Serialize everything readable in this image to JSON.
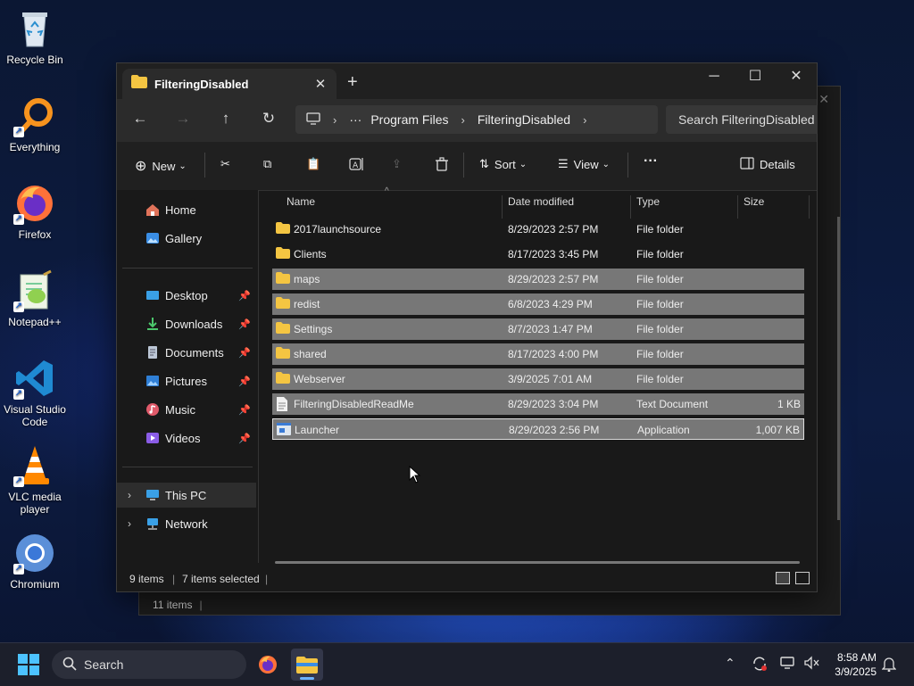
{
  "desktop": {
    "icons": [
      {
        "label": "Recycle Bin"
      },
      {
        "label": "Everything"
      },
      {
        "label": "Firefox"
      },
      {
        "label": "Notepad++"
      },
      {
        "label": "Visual Studio Code"
      },
      {
        "label": "VLC media player"
      },
      {
        "label": "Chromium"
      }
    ]
  },
  "background_window": {
    "status": "11 items"
  },
  "window": {
    "tab_title": "FilteringDisabled",
    "new_tab": "+",
    "controls": {
      "minimize": "─",
      "maximize": "☐",
      "close": "✕"
    },
    "breadcrumb": [
      "Program Files",
      "FilteringDisabled"
    ],
    "breadcrumb_more": "···",
    "search_placeholder": "Search FilteringDisabled",
    "toolbar": {
      "new_label": "New",
      "sort_label": "Sort",
      "view_label": "View",
      "more_label": "···",
      "details_label": "Details"
    },
    "sidebar": {
      "home": "Home",
      "gallery": "Gallery",
      "desktop": "Desktop",
      "downloads": "Downloads",
      "documents": "Documents",
      "pictures": "Pictures",
      "music": "Music",
      "videos": "Videos",
      "this_pc": "This PC",
      "network": "Network"
    },
    "columns": {
      "name": "Name",
      "date": "Date modified",
      "type": "Type",
      "size": "Size"
    },
    "files": [
      {
        "name": "2017launchsource",
        "date": "8/29/2023 2:57 PM",
        "type": "File folder",
        "size": "",
        "selected": false,
        "kind": "folder"
      },
      {
        "name": "Clients",
        "date": "8/17/2023 3:45 PM",
        "type": "File folder",
        "size": "",
        "selected": false,
        "kind": "folder"
      },
      {
        "name": "maps",
        "date": "8/29/2023 2:57 PM",
        "type": "File folder",
        "size": "",
        "selected": true,
        "kind": "folder"
      },
      {
        "name": "redist",
        "date": "6/8/2023 4:29 PM",
        "type": "File folder",
        "size": "",
        "selected": true,
        "kind": "folder"
      },
      {
        "name": "Settings",
        "date": "8/7/2023 1:47 PM",
        "type": "File folder",
        "size": "",
        "selected": true,
        "kind": "folder"
      },
      {
        "name": "shared",
        "date": "8/17/2023 4:00 PM",
        "type": "File folder",
        "size": "",
        "selected": true,
        "kind": "folder"
      },
      {
        "name": "Webserver",
        "date": "3/9/2025 7:01 AM",
        "type": "File folder",
        "size": "",
        "selected": true,
        "kind": "folder"
      },
      {
        "name": "FilteringDisabledReadMe",
        "date": "8/29/2023 3:04 PM",
        "type": "Text Document",
        "size": "1 KB",
        "selected": true,
        "kind": "text"
      },
      {
        "name": "Launcher",
        "date": "8/29/2023 2:56 PM",
        "type": "Application",
        "size": "1,007 KB",
        "selected": true,
        "kind": "app"
      }
    ],
    "status": {
      "items": "9 items",
      "selected": "7 items selected"
    }
  },
  "taskbar": {
    "search_placeholder": "Search",
    "time": "8:58 AM",
    "date": "3/9/2025"
  }
}
